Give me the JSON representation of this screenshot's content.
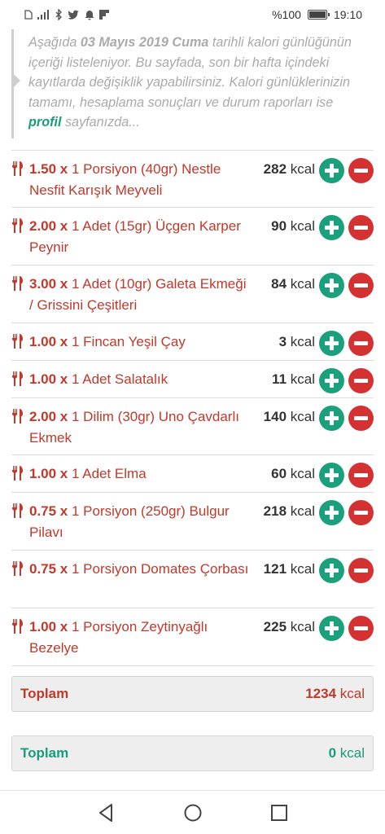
{
  "status_bar": {
    "left_icons": [
      "sim-icon",
      "signal-icon",
      "bluetooth-icon",
      "twitter-icon",
      "notification-bell-icon",
      "flipboard-icon"
    ],
    "battery_text": "%100",
    "battery_level": 1.0,
    "time": "19:10"
  },
  "intro": {
    "text_1": "Aşağıda ",
    "date": "03 Mayıs 2019 Cuma",
    "text_2": " tarihli kalori günlüğünün içeriği listeleniyor. Bu sayfada, son bir hafta içindeki kayıtlarda değişiklik yapabilirsiniz. Kalori günlüklerinizin tamamı, hesaplama sonuçları ve durum raporları ise ",
    "link": "profil",
    "text_3": " sayfanızda..."
  },
  "colors": {
    "accent_red": "#c0392b",
    "accent_green": "#1a9b7c",
    "plus_button": "#1aa07c",
    "minus_button": "#d43232"
  },
  "items": [
    {
      "qty": "1.50 x",
      "desc": " 1 Porsiyon (40gr) Nestle Nesfit Karışık Meyveli",
      "kcal_value": "282",
      "kcal_unit": " kcal"
    },
    {
      "qty": "2.00 x",
      "desc": " 1 Adet (15gr) Üçgen Karper Peynir",
      "kcal_value": "90",
      "kcal_unit": " kcal"
    },
    {
      "qty": "3.00 x",
      "desc": " 1 Adet (10gr) Galeta Ekmeği / Grissini Çeşitleri",
      "kcal_value": "84",
      "kcal_unit": " kcal"
    },
    {
      "qty": "1.00 x",
      "desc": " 1 Fincan Yeşil Çay",
      "kcal_value": "3",
      "kcal_unit": " kcal"
    },
    {
      "qty": "1.00 x",
      "desc": " 1 Adet Salatalık",
      "kcal_value": "11",
      "kcal_unit": " kcal"
    },
    {
      "qty": "2.00 x",
      "desc": " 1 Dilim (30gr) Uno Çavdarlı Ekmek",
      "kcal_value": "140",
      "kcal_unit": " kcal"
    },
    {
      "qty": "1.00 x",
      "desc": " 1 Adet Elma",
      "kcal_value": "60",
      "kcal_unit": " kcal"
    },
    {
      "qty": "0.75 x",
      "desc": " 1 Porsiyon (250gr) Bulgur Pilavı",
      "kcal_value": "218",
      "kcal_unit": " kcal"
    },
    {
      "qty": "0.75 x",
      "desc": " 1 Porsiyon Domates Çorbası",
      "kcal_value": "121",
      "kcal_unit": " kcal"
    },
    {
      "qty": "1.00 x",
      "desc": " 1 Porsiyon Zeytinyağlı Bezelye",
      "kcal_value": "225",
      "kcal_unit": " kcal"
    }
  ],
  "totals": [
    {
      "label": "Toplam",
      "value": "1234",
      "unit": " kcal"
    },
    {
      "label": "Toplam",
      "value": "0",
      "unit": " kcal"
    }
  ],
  "nav": {
    "back": "back-triangle-icon",
    "home": "home-circle-icon",
    "recents": "recents-square-icon"
  }
}
